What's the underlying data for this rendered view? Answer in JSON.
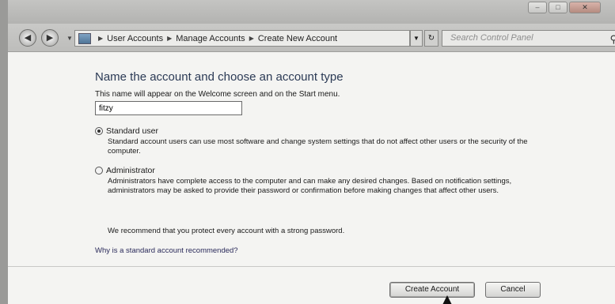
{
  "window": {
    "caption_buttons": [
      "minimize",
      "maximize",
      "close"
    ]
  },
  "toolbar": {
    "back_icon": "back-arrow-icon",
    "forward_icon": "forward-arrow-icon",
    "breadcrumbs": [
      "User Accounts",
      "Manage Accounts",
      "Create New Account"
    ],
    "search_placeholder": "Search Control Panel"
  },
  "form": {
    "heading": "Name the account and choose an account type",
    "subtext": "This name will appear on the Welcome screen and on the Start menu.",
    "name_value": "fitzy",
    "options": [
      {
        "label": "Standard user",
        "selected": true,
        "description": "Standard account users can use most software and change system settings that do not affect other users or the security of the computer."
      },
      {
        "label": "Administrator",
        "selected": false,
        "description": "Administrators have complete access to the computer and can make any desired changes. Based on notification settings, administrators may be asked to provide their password or confirmation before making changes that affect other users."
      }
    ],
    "recommendation": "We recommend that you protect every account with a strong password.",
    "help_link": "Why is a standard account recommended?"
  },
  "buttons": {
    "create": "Create Account",
    "cancel": "Cancel"
  }
}
